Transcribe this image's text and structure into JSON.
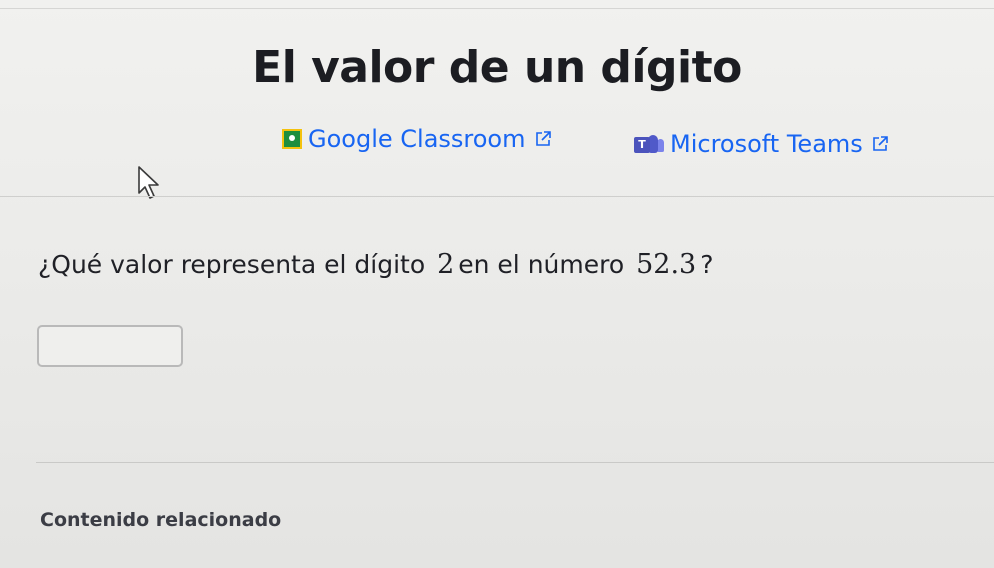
{
  "page": {
    "title": "El valor de un dígito"
  },
  "share": {
    "classroom_label": "Google Classroom",
    "teams_label": "Microsoft Teams"
  },
  "question": {
    "prefix": "¿Qué valor representa el dígito",
    "digit": "2",
    "middle": "en el número",
    "number": "52.3",
    "suffix": "?"
  },
  "answer": {
    "value": "",
    "placeholder": ""
  },
  "related": {
    "heading": "Contenido relacionado"
  },
  "colors": {
    "link": "#1865f2",
    "classroom_green": "#1e8e3e",
    "teams_purple": "#5059c9"
  },
  "icons": [
    "google-classroom-icon",
    "external-link-icon",
    "microsoft-teams-icon",
    "mouse-cursor-icon"
  ]
}
